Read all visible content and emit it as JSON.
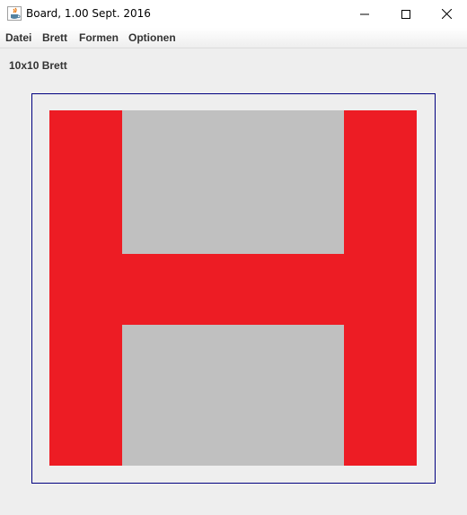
{
  "window": {
    "title": "Board, 1.00 Sept. 2016",
    "icon": "java-cup-icon",
    "controls": [
      "minimize-icon",
      "maximize-icon",
      "close-icon"
    ]
  },
  "menubar": {
    "items": [
      "Datei",
      "Brett",
      "Formen",
      "Optionen"
    ]
  },
  "board": {
    "label": "10x10 Brett",
    "rows": 10,
    "cols": 10,
    "colors": {
      "empty": "#c0c0c0",
      "filled": "#ed1c24",
      "frame": "#000080"
    },
    "shape_letter": "H"
  }
}
